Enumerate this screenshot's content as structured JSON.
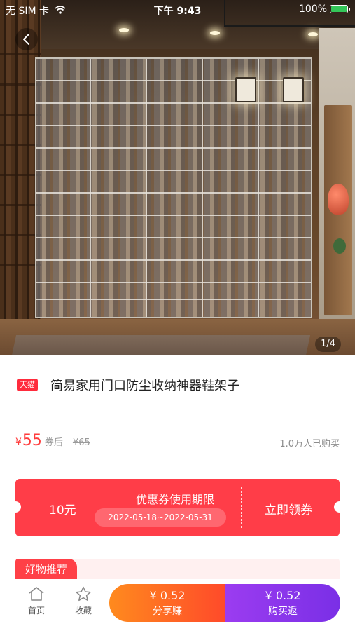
{
  "status_bar": {
    "carrier": "无 SIM 卡",
    "time": "下午 9:43",
    "battery": "100%"
  },
  "gallery": {
    "pager": "1/4"
  },
  "product": {
    "platform_badge": "天猫",
    "title": "简易家用门口防尘收纳神器鞋架子"
  },
  "price": {
    "currency": "¥",
    "value": "55",
    "after_coupon_label": "券后",
    "original": "¥65",
    "sold": "1.0万人已购买"
  },
  "coupon": {
    "amount": "10元",
    "title": "优惠券使用期限",
    "dates": "2022-05-18~2022-05-31",
    "claim": "立即领券"
  },
  "recommend": {
    "label": "好物推荐"
  },
  "bottom_bar": {
    "home_label": "首页",
    "favorite_label": "收藏",
    "share_price": "¥ 0.52",
    "share_label": "分享赚",
    "buy_price": "¥ 0.52",
    "buy_label": "购买返"
  },
  "colors": {
    "accent_red": "#ff3d48",
    "share_orange": "#ff6a24",
    "buy_purple": "#8a36ea"
  },
  "icons": [
    "wifi-icon",
    "battery-icon",
    "back-arrow-icon",
    "home-icon",
    "star-icon"
  ]
}
